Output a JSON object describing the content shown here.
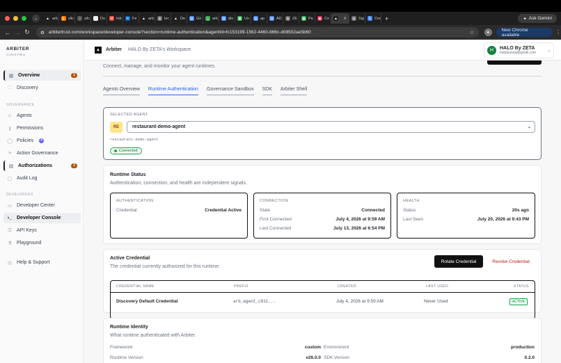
{
  "browser": {
    "tabs": [
      {
        "label": "arb",
        "icon": "triangle-icon",
        "color": "#222222"
      },
      {
        "label": "zilc",
        "icon": "hand-icon",
        "color": "#f97316"
      },
      {
        "label": "zilc",
        "icon": "circle-icon",
        "color": "#555555"
      },
      {
        "label": "Do",
        "icon": "circle-icon",
        "color": "#eeeeee"
      },
      {
        "label": "Inb",
        "icon": "gmail-icon",
        "color": "#ea4335"
      },
      {
        "label": "Fe",
        "icon": "linkedin-icon",
        "color": "#0a66c2"
      },
      {
        "label": "arb",
        "icon": "triangle-icon",
        "color": "#222222"
      },
      {
        "label": "loc",
        "icon": "globe-icon",
        "color": "#666666"
      },
      {
        "label": "De",
        "icon": "triangle-icon",
        "color": "#222222"
      },
      {
        "label": "Go",
        "icon": "doc-icon",
        "color": "#4285f4"
      },
      {
        "label": "arb",
        "icon": "drive-icon",
        "color": "#34a853"
      },
      {
        "label": "dis",
        "icon": "doc-icon",
        "color": "#4285f4"
      },
      {
        "label": "Un",
        "icon": "sheet-icon",
        "color": "#34a853"
      },
      {
        "label": "ap",
        "icon": "doc-icon",
        "color": "#4285f4"
      },
      {
        "label": "AD",
        "icon": "doc-icon",
        "color": "#4285f4"
      },
      {
        "label": "ZE",
        "icon": "globe-icon",
        "color": "#666666"
      },
      {
        "label": "Pa",
        "icon": "sheet-icon",
        "color": "#34a853"
      },
      {
        "label": "Co",
        "icon": "box-icon",
        "color": "#e11d48"
      },
      {
        "label": "",
        "icon": "triangle-icon",
        "color": "#222222",
        "active": true
      },
      {
        "label": "Sig",
        "icon": "globe-icon",
        "color": "#666666"
      },
      {
        "label": "Cre",
        "icon": "google-icon",
        "color": "#4285f4"
      }
    ],
    "new_tab": "+",
    "ask_gemini": "Ask Gemini",
    "url": "arbitertrust.com/workspace/developer-console?section=runtime-authentication&agentId=fc153199-1562-4460-866c-d08502ae5b60",
    "new_chrome": "New Chrome available"
  },
  "sidebar": {
    "brand": "ARBITER",
    "brand_sub": "Control Plane",
    "overview": "Overview",
    "overview_badge": "1",
    "discovery": "Discovery",
    "group_governance": "GOVERNANCE",
    "agents": "Agents",
    "permissions": "Permissions",
    "policies": "Policies",
    "policies_badge": "4",
    "action_governance": "Action Governance",
    "authorizations": "Authorizations",
    "authorizations_badge": "1",
    "audit_log": "Audit Log",
    "group_developers": "DEVELOPERS",
    "developer_center": "Developer Center",
    "developer_console": "Developer Console",
    "api_keys": "API Keys",
    "playground": "Playground",
    "help": "Help & Support"
  },
  "topbar": {
    "app_name": "Arbiter",
    "workspace": "HALO By ZETA's Workspace",
    "user_initial": "H",
    "user_name": "HALO By ZETA",
    "user_email": "halobyzeta@gmail.com"
  },
  "main": {
    "subtitle": "Connect, manage, and monitor your agent runtimes.",
    "tabs": [
      "Agents Overview",
      "Runtime Authentication",
      "Governance Sandbox",
      "SDK",
      "Arbiter Shell"
    ],
    "selected_agent": {
      "label": "SELECTED AGENT",
      "initials": "RE",
      "name": "restaurant-demo-agent",
      "slug": "restaurant-demo-agent",
      "status": "Connected"
    },
    "runtime_status": {
      "title": "Runtime Status",
      "desc": "Authentication, connection, and health are independent signals.",
      "auth": {
        "title": "AUTHENTICATION",
        "credential_k": "Credential",
        "credential_v": "Credential Active"
      },
      "conn": {
        "title": "CONNECTION",
        "state_k": "State",
        "state_v": "Connected",
        "first_k": "First Connected",
        "first_v": "July 4, 2026 at 9:59 AM",
        "last_k": "Last Connected",
        "last_v": "July 13, 2026 at 6:54 PM"
      },
      "health": {
        "title": "HEALTH",
        "status_k": "Status",
        "status_v": "20s ago",
        "seen_k": "Last Seen",
        "seen_v": "July 20, 2026 at 9:43 PM"
      }
    },
    "active_credential": {
      "title": "Active Credential",
      "desc": "The credential currently authorized for this runtime.",
      "rotate": "Rotate Credential",
      "revoke": "Revoke Credential",
      "columns": [
        "CREDENTIAL NAME",
        "PREFIX",
        "CREATED",
        "LAST USED",
        "STATUS"
      ],
      "row": {
        "name": "Discovery Default Credential",
        "prefix": "arb_agent_c811...",
        "created": "July 4, 2026 at 9:59 AM",
        "last_used": "Never Used",
        "status": "ACTIVE"
      }
    },
    "runtime_identity": {
      "title": "Runtime Identity",
      "desc": "What runtime authenticated with Arbiter.",
      "framework_k": "Framework",
      "framework_v": "custom",
      "environment_k": "Environment",
      "environment_v": "production",
      "runtime_version_k": "Runtime Version",
      "runtime_version_v": "v26.0.0",
      "sdk_version_k": "SDK Version",
      "sdk_version_v": "0.2.0"
    }
  }
}
